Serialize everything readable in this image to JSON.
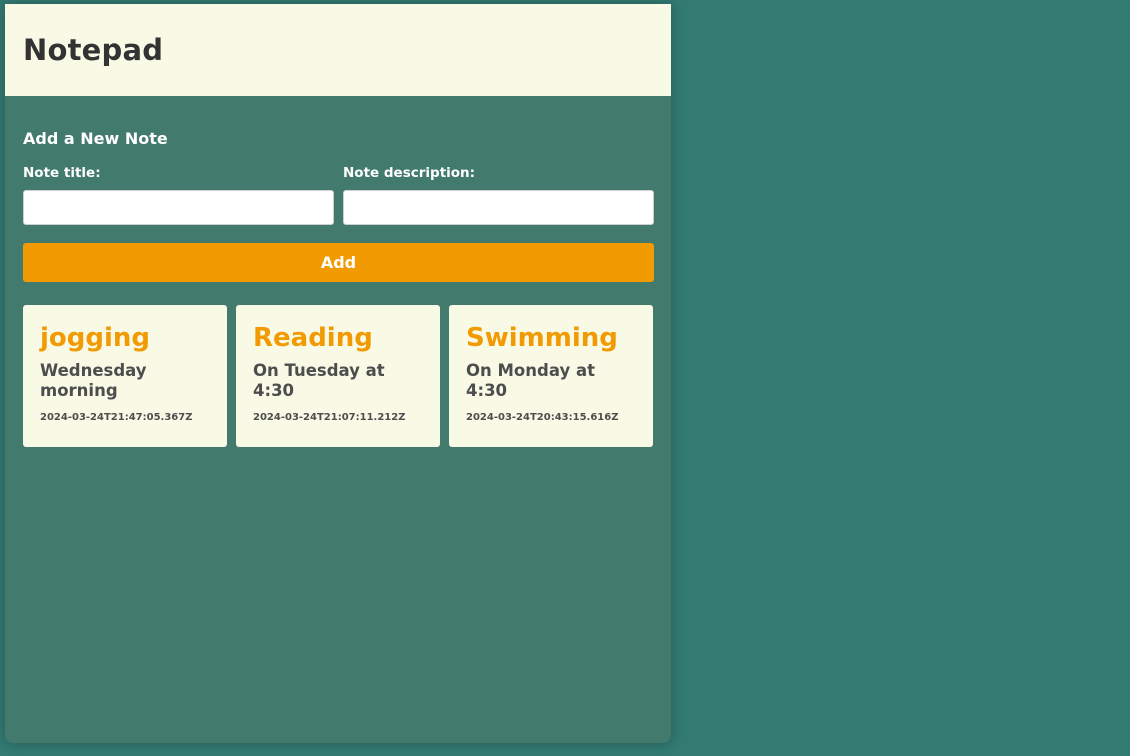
{
  "header": {
    "title": "Notepad"
  },
  "form": {
    "heading": "Add a New Note",
    "title_label": "Note title:",
    "title_value": "",
    "description_label": "Note description:",
    "description_value": "",
    "add_label": "Add"
  },
  "notes": [
    {
      "title": "jogging",
      "description": "Wednesday morning",
      "timestamp": "2024-03-24T21:47:05.367Z"
    },
    {
      "title": "Reading",
      "description": "On Tuesday at 4:30",
      "timestamp": "2024-03-24T21:07:11.212Z"
    },
    {
      "title": "Swimming",
      "description": "On Monday at 4:30",
      "timestamp": "2024-03-24T20:43:15.616Z"
    }
  ],
  "colors": {
    "page_background": "#327a72",
    "panel_background": "#437a6e",
    "header_background": "#f9fae6",
    "accent": "#f29a02",
    "card_background": "#f9fae6"
  }
}
